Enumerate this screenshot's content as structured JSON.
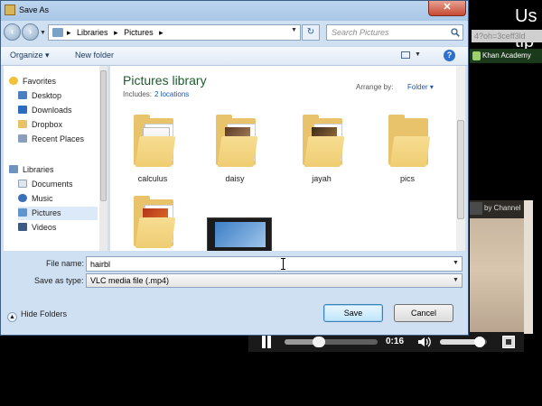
{
  "background_page": {
    "title_fragment": "Us\ntip",
    "url_fragment": "4?oh=3ceff3ld",
    "site_label": "Khan Academy",
    "channel_label": "by Channel"
  },
  "video_player": {
    "timecode": "0:16",
    "progress": 0.37,
    "volume": 0.85
  },
  "dialog": {
    "title": "Save As",
    "close_label": "✕",
    "breadcrumbs": [
      "Libraries",
      "Pictures"
    ],
    "search_placeholder": "Search Pictures",
    "toolbar": {
      "organize_label": "Organize ▾",
      "new_folder_label": "New folder",
      "help_label": "?"
    },
    "nav": {
      "favorites_header": "Favorites",
      "favorites": [
        "Desktop",
        "Downloads",
        "Dropbox",
        "Recent Places"
      ],
      "libraries_header": "Libraries",
      "libraries": [
        "Documents",
        "Music",
        "Pictures",
        "Videos"
      ],
      "selected": "Pictures"
    },
    "content": {
      "library_title": "Pictures library",
      "includes_label": "Includes:",
      "includes_link": "2 locations",
      "arrange_label": "Arrange by:",
      "arrange_value": "Folder ▾",
      "items": [
        {
          "name": "calculus",
          "kind": "folder"
        },
        {
          "name": "daisy",
          "kind": "folder"
        },
        {
          "name": "jayah",
          "kind": "folder"
        },
        {
          "name": "pics",
          "kind": "folder"
        },
        {
          "name": "",
          "kind": "folder"
        },
        {
          "name": "",
          "kind": "video"
        }
      ]
    },
    "file_name_label": "File name:",
    "file_name_value": "hairbl",
    "save_as_type_label": "Save as type:",
    "save_as_type_value": "VLC media file (.mp4)",
    "hide_folders_label": "Hide Folders",
    "save_button": "Save",
    "cancel_button": "Cancel"
  },
  "colors": {
    "dialog_frame": "#cfe0f2",
    "library_title": "#1e5a2e",
    "link": "#1a56b4",
    "folder": "#e8c36c",
    "close_button": "#c74a34"
  }
}
